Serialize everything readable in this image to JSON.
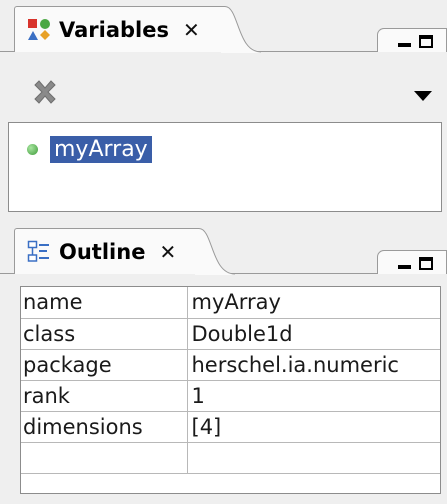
{
  "variables_view": {
    "tab_title": "Variables",
    "close_label": "✕",
    "items": [
      {
        "name": "myArray",
        "selected": true
      }
    ]
  },
  "outline_view": {
    "tab_title": "Outline",
    "close_label": "✕",
    "properties": [
      {
        "key": "name",
        "value": "myArray"
      },
      {
        "key": "class",
        "value": "Double1d"
      },
      {
        "key": "package",
        "value": "herschel.ia.numeric"
      },
      {
        "key": "rank",
        "value": "1"
      },
      {
        "key": "dimensions",
        "value": "[4]"
      }
    ]
  },
  "icons": {
    "variables_tab": "variables-icon",
    "outline_tab": "outline-icon",
    "remove": "remove-variable-icon",
    "view_menu": "chevron-down-icon",
    "minimize": "minimize-icon",
    "maximize": "maximize-icon"
  },
  "colors": {
    "selection": "#3a5ea8",
    "background": "#efefef",
    "dot": "#3e9a3a"
  }
}
